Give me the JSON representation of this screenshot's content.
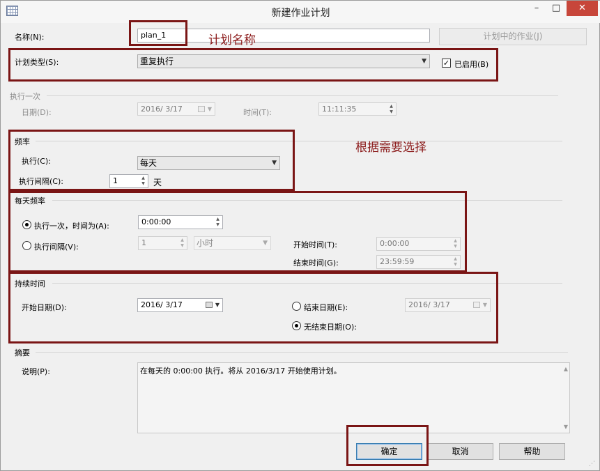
{
  "window": {
    "title": "新建作业计划",
    "minimize": "–",
    "maximize": "□",
    "close": "✕"
  },
  "name_row": {
    "label": "名称(N):",
    "value": "plan_1",
    "jobs_button": "计划中的作业(J)"
  },
  "schedule_type": {
    "label": "计划类型(S):",
    "value": "重复执行",
    "enabled_label": "已启用(B)",
    "enabled_checked": true
  },
  "once": {
    "heading": "执行一次",
    "date_label": "日期(D):",
    "date_value": "2016/ 3/17",
    "time_label": "时间(T):",
    "time_value": "11:11:35"
  },
  "frequency": {
    "heading": "频率",
    "occurs_label": "执行(C):",
    "occurs_value": "每天",
    "interval_label": "执行间隔(C):",
    "interval_value": "1",
    "interval_unit": "天"
  },
  "daily": {
    "heading": "每天频率",
    "once_label": "执行一次，时间为(A):",
    "once_value": "0:00:00",
    "once_selected": true,
    "every_label": "执行间隔(V):",
    "every_value": "1",
    "every_unit": "小时",
    "start_label": "开始时间(T):",
    "start_value": "0:00:00",
    "end_label": "结束时间(G):",
    "end_value": "23:59:59"
  },
  "duration": {
    "heading": "持续时间",
    "start_label": "开始日期(D):",
    "start_value": "2016/ 3/17",
    "end_label": "结束日期(E):",
    "end_value": "2016/ 3/17",
    "no_end_label": "无结束日期(O):",
    "no_end_selected": true
  },
  "summary": {
    "heading": "摘要",
    "desc_label": "说明(P):",
    "desc_value": "在每天的 0:00:00 执行。将从 2016/3/17 开始使用计划。"
  },
  "buttons": {
    "ok": "确定",
    "cancel": "取消",
    "help": "帮助"
  },
  "annotations": {
    "name_note": "计划名称",
    "choose_note": "根据需要选择"
  },
  "colors": {
    "annotation": "#7a1515",
    "close_button": "#c7463a"
  }
}
